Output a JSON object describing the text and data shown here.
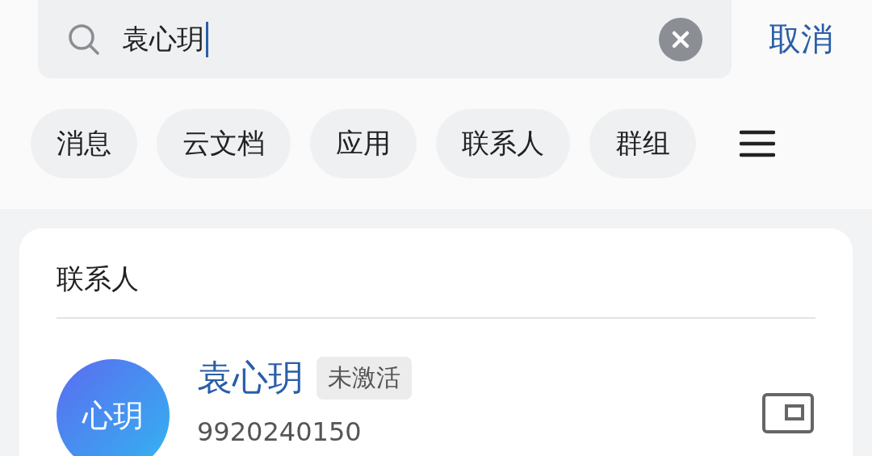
{
  "search": {
    "value": "袁心玥",
    "cancel": "取消"
  },
  "filters": [
    {
      "label": "消息"
    },
    {
      "label": "云文档"
    },
    {
      "label": "应用"
    },
    {
      "label": "联系人"
    },
    {
      "label": "群组"
    }
  ],
  "section": {
    "title": "联系人",
    "contacts": [
      {
        "name": "袁心玥",
        "badge": "未激活",
        "avatar": "心玥",
        "number": "9920240150"
      }
    ]
  }
}
